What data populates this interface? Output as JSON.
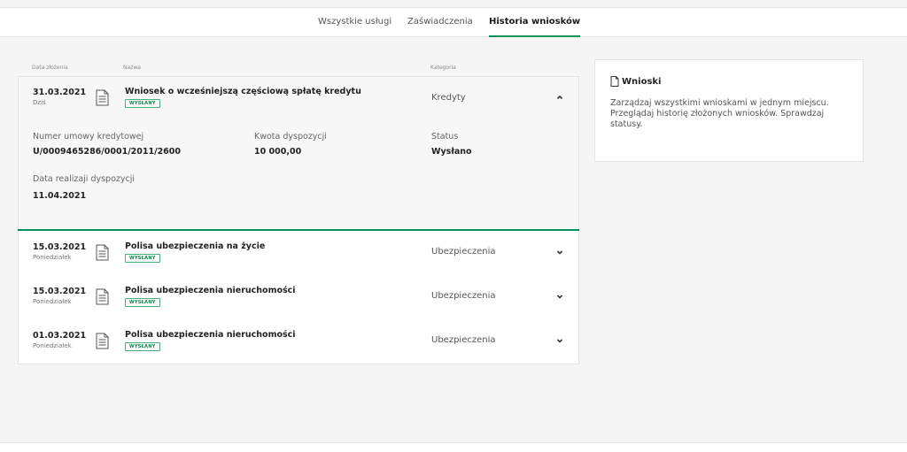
{
  "tabs": {
    "all_services": "Wszystkie usługi",
    "certificates": "Zaświadczenia",
    "history": "Historia wniosków"
  },
  "columns": {
    "date": "Data złożenia",
    "name": "Nazwa",
    "category": "Kategoria"
  },
  "expanded": {
    "date": "31.03.2021",
    "day": "Dziś",
    "title": "Wniosek o wcześniejszą częściową spłatę kredytu",
    "badge": "WYSŁANY",
    "category": "Kredyty",
    "details": {
      "contract_label": "Numer umowy kredytowej",
      "contract_value": "U/0009465286/0001/2011/2600",
      "amount_label": "Kwota dyspozycji",
      "amount_value": "10 000,00",
      "status_label": "Status",
      "status_value": "Wysłano",
      "realization_label": "Data realizaji dyspozycji",
      "realization_value": "11.04.2021"
    }
  },
  "rows": [
    {
      "date": "15.03.2021",
      "day": "Poniedziałek",
      "title": "Polisa ubezpieczenia na życie",
      "badge": "WYSŁANY",
      "category": "Ubezpieczenia"
    },
    {
      "date": "15.03.2021",
      "day": "Poniedziałek",
      "title": "Polisa ubezpieczenia nieruchomości",
      "badge": "WYSŁANY",
      "category": "Ubezpieczenia"
    },
    {
      "date": "01.03.2021",
      "day": "Poniedziałek",
      "title": "Polisa ubezpieczenia nieruchomości",
      "badge": "WYSŁANY",
      "category": "Ubezpieczenia"
    }
  ],
  "side": {
    "title": "Wnioski",
    "text": "Zarządzaj wszystkimi wnioskami w jednym miejscu. Przeglądaj historię złożonych wniosków. Sprawdzaj statusy."
  },
  "icons": {
    "document": "document-icon",
    "chevron_up": "chevron-up-icon",
    "chevron_down": "chevron-down-icon"
  },
  "colors": {
    "accent": "#00915a",
    "background": "#f4f5f4",
    "card": "#ffffff"
  }
}
